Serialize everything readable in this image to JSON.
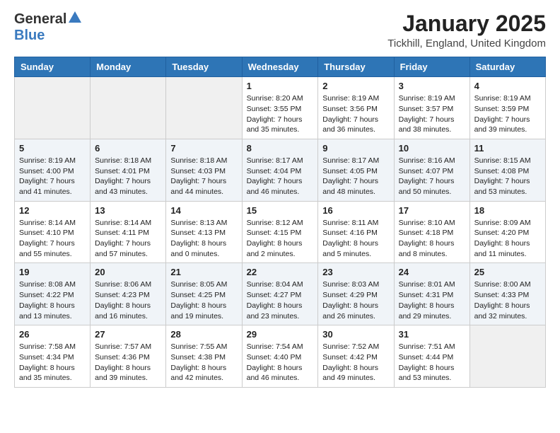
{
  "header": {
    "logo_general": "General",
    "logo_blue": "Blue",
    "month_title": "January 2025",
    "location": "Tickhill, England, United Kingdom"
  },
  "days_of_week": [
    "Sunday",
    "Monday",
    "Tuesday",
    "Wednesday",
    "Thursday",
    "Friday",
    "Saturday"
  ],
  "weeks": [
    [
      {
        "day": "",
        "info": ""
      },
      {
        "day": "",
        "info": ""
      },
      {
        "day": "",
        "info": ""
      },
      {
        "day": "1",
        "info": "Sunrise: 8:20 AM\nSunset: 3:55 PM\nDaylight: 7 hours and 35 minutes."
      },
      {
        "day": "2",
        "info": "Sunrise: 8:19 AM\nSunset: 3:56 PM\nDaylight: 7 hours and 36 minutes."
      },
      {
        "day": "3",
        "info": "Sunrise: 8:19 AM\nSunset: 3:57 PM\nDaylight: 7 hours and 38 minutes."
      },
      {
        "day": "4",
        "info": "Sunrise: 8:19 AM\nSunset: 3:59 PM\nDaylight: 7 hours and 39 minutes."
      }
    ],
    [
      {
        "day": "5",
        "info": "Sunrise: 8:19 AM\nSunset: 4:00 PM\nDaylight: 7 hours and 41 minutes."
      },
      {
        "day": "6",
        "info": "Sunrise: 8:18 AM\nSunset: 4:01 PM\nDaylight: 7 hours and 43 minutes."
      },
      {
        "day": "7",
        "info": "Sunrise: 8:18 AM\nSunset: 4:03 PM\nDaylight: 7 hours and 44 minutes."
      },
      {
        "day": "8",
        "info": "Sunrise: 8:17 AM\nSunset: 4:04 PM\nDaylight: 7 hours and 46 minutes."
      },
      {
        "day": "9",
        "info": "Sunrise: 8:17 AM\nSunset: 4:05 PM\nDaylight: 7 hours and 48 minutes."
      },
      {
        "day": "10",
        "info": "Sunrise: 8:16 AM\nSunset: 4:07 PM\nDaylight: 7 hours and 50 minutes."
      },
      {
        "day": "11",
        "info": "Sunrise: 8:15 AM\nSunset: 4:08 PM\nDaylight: 7 hours and 53 minutes."
      }
    ],
    [
      {
        "day": "12",
        "info": "Sunrise: 8:14 AM\nSunset: 4:10 PM\nDaylight: 7 hours and 55 minutes."
      },
      {
        "day": "13",
        "info": "Sunrise: 8:14 AM\nSunset: 4:11 PM\nDaylight: 7 hours and 57 minutes."
      },
      {
        "day": "14",
        "info": "Sunrise: 8:13 AM\nSunset: 4:13 PM\nDaylight: 8 hours and 0 minutes."
      },
      {
        "day": "15",
        "info": "Sunrise: 8:12 AM\nSunset: 4:15 PM\nDaylight: 8 hours and 2 minutes."
      },
      {
        "day": "16",
        "info": "Sunrise: 8:11 AM\nSunset: 4:16 PM\nDaylight: 8 hours and 5 minutes."
      },
      {
        "day": "17",
        "info": "Sunrise: 8:10 AM\nSunset: 4:18 PM\nDaylight: 8 hours and 8 minutes."
      },
      {
        "day": "18",
        "info": "Sunrise: 8:09 AM\nSunset: 4:20 PM\nDaylight: 8 hours and 11 minutes."
      }
    ],
    [
      {
        "day": "19",
        "info": "Sunrise: 8:08 AM\nSunset: 4:22 PM\nDaylight: 8 hours and 13 minutes."
      },
      {
        "day": "20",
        "info": "Sunrise: 8:06 AM\nSunset: 4:23 PM\nDaylight: 8 hours and 16 minutes."
      },
      {
        "day": "21",
        "info": "Sunrise: 8:05 AM\nSunset: 4:25 PM\nDaylight: 8 hours and 19 minutes."
      },
      {
        "day": "22",
        "info": "Sunrise: 8:04 AM\nSunset: 4:27 PM\nDaylight: 8 hours and 23 minutes."
      },
      {
        "day": "23",
        "info": "Sunrise: 8:03 AM\nSunset: 4:29 PM\nDaylight: 8 hours and 26 minutes."
      },
      {
        "day": "24",
        "info": "Sunrise: 8:01 AM\nSunset: 4:31 PM\nDaylight: 8 hours and 29 minutes."
      },
      {
        "day": "25",
        "info": "Sunrise: 8:00 AM\nSunset: 4:33 PM\nDaylight: 8 hours and 32 minutes."
      }
    ],
    [
      {
        "day": "26",
        "info": "Sunrise: 7:58 AM\nSunset: 4:34 PM\nDaylight: 8 hours and 35 minutes."
      },
      {
        "day": "27",
        "info": "Sunrise: 7:57 AM\nSunset: 4:36 PM\nDaylight: 8 hours and 39 minutes."
      },
      {
        "day": "28",
        "info": "Sunrise: 7:55 AM\nSunset: 4:38 PM\nDaylight: 8 hours and 42 minutes."
      },
      {
        "day": "29",
        "info": "Sunrise: 7:54 AM\nSunset: 4:40 PM\nDaylight: 8 hours and 46 minutes."
      },
      {
        "day": "30",
        "info": "Sunrise: 7:52 AM\nSunset: 4:42 PM\nDaylight: 8 hours and 49 minutes."
      },
      {
        "day": "31",
        "info": "Sunrise: 7:51 AM\nSunset: 4:44 PM\nDaylight: 8 hours and 53 minutes."
      },
      {
        "day": "",
        "info": ""
      }
    ]
  ]
}
